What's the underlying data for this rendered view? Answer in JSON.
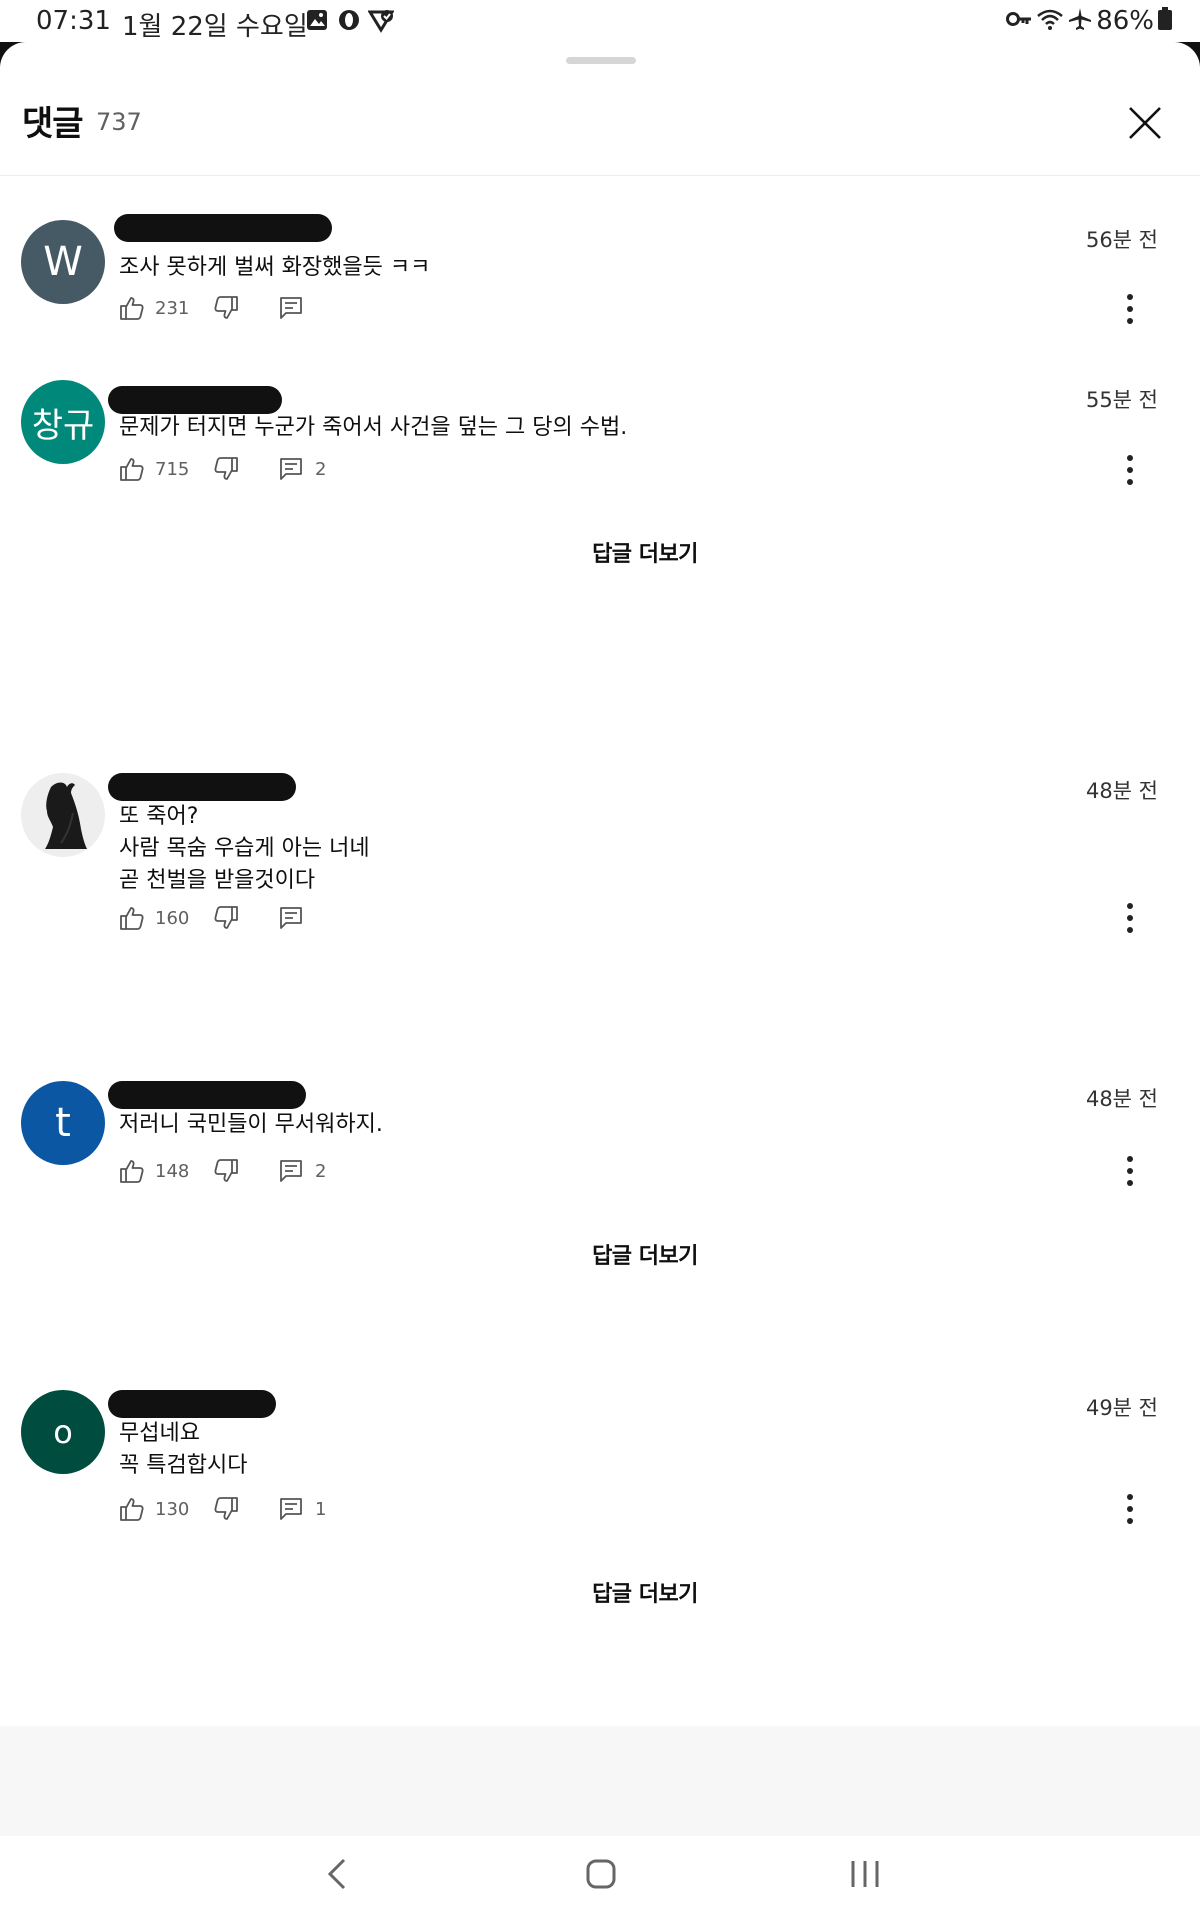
{
  "status_bar": {
    "time": "07:31",
    "date": "1월 22일 수요일",
    "battery": "86%"
  },
  "panel": {
    "title": "댓글",
    "count": "737"
  },
  "comments": [
    {
      "avatar_letter": "W",
      "avatar_color": "#455a64",
      "text": "조사 못하게 벌써 화장했을듯 ㅋㅋ",
      "time": "56분 전",
      "likes": "231",
      "replies": ""
    },
    {
      "avatar_letter": "창규",
      "avatar_color": "#00897b",
      "text": "문제가 터지면 누군가 죽어서 사건을 덮는 그 당의 수법.",
      "time": "55분 전",
      "likes": "715",
      "replies": "2",
      "more_replies_label": "답글 더보기"
    },
    {
      "avatar_letter": "",
      "avatar_color": "#eeeeee",
      "text": "또 죽어?\n사람 목숨 우습게 아는 너네\n곧 천벌을 받을것이다",
      "time": "48분 전",
      "likes": "160",
      "replies": ""
    },
    {
      "avatar_letter": "t",
      "avatar_color": "#0b57a4",
      "text": "저러니 국민들이 무서워하지.",
      "time": "48분 전",
      "likes": "148",
      "replies": "2",
      "more_replies_label": "답글 더보기"
    },
    {
      "avatar_letter": "o",
      "avatar_color": "#004d40",
      "text": "무섭네요\n꼭 특검합시다",
      "time": "49분 전",
      "likes": "130",
      "replies": "1",
      "more_replies_label": "답글 더보기"
    }
  ],
  "colors": {
    "text_primary": "#0f0f0f",
    "text_secondary": "#606060",
    "background": "#ffffff"
  },
  "icons": {
    "close": "close-icon",
    "like": "thumbs-up-icon",
    "dislike": "thumbs-down-icon",
    "reply": "reply-icon",
    "more": "more-vert-icon",
    "nav_back": "back-icon",
    "nav_home": "home-icon",
    "nav_recents": "recents-icon"
  }
}
